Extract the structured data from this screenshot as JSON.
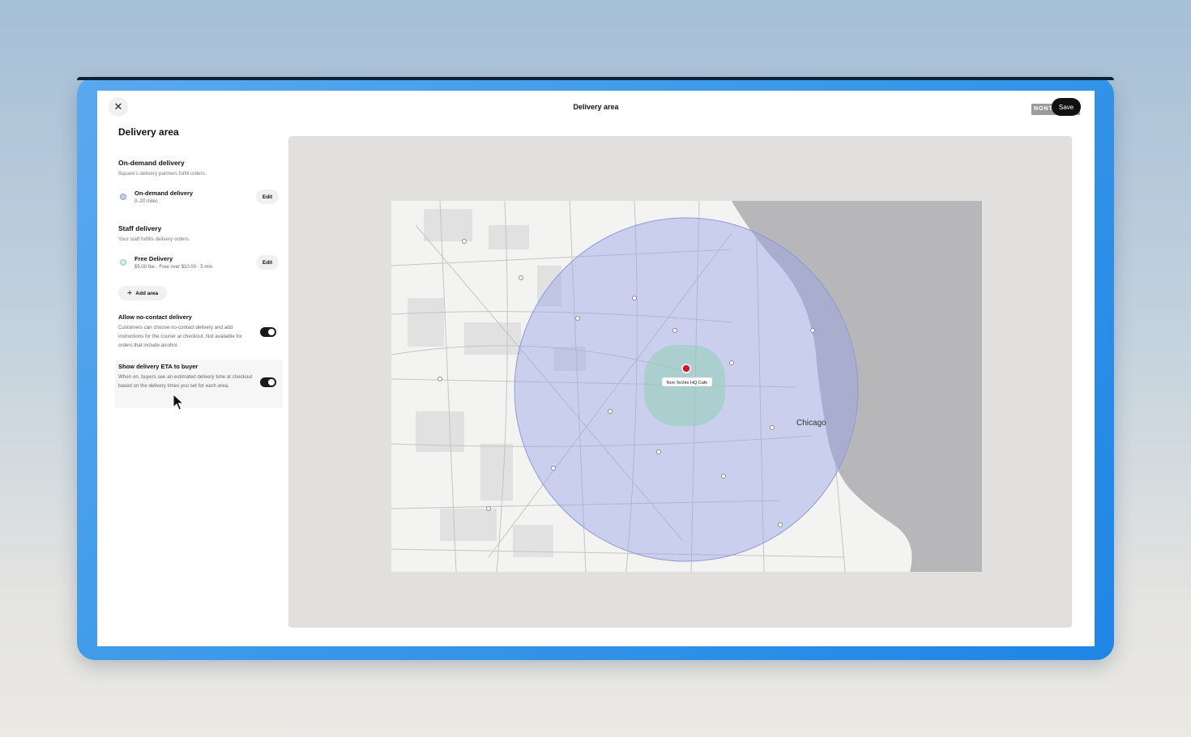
{
  "window": {
    "title": "Delivery area",
    "brand_tag": "NONT",
    "save_label": "Save",
    "close_icon": "close-icon"
  },
  "sidebar": {
    "heading": "Delivery area",
    "on_demand": {
      "title": "On-demand delivery",
      "subtitle": "Square's delivery partners fulfill orders.",
      "area": {
        "name": "On-demand delivery",
        "detail": "0–20 miles",
        "color": "#aab4e6",
        "edit_label": "Edit"
      }
    },
    "staff": {
      "title": "Staff delivery",
      "subtitle": "Your staff fulfills delivery orders.",
      "area": {
        "name": "Free Delivery",
        "detail": "$5.00 fee · Free over $10.00 · 5 min",
        "color": "#a8dcc6",
        "edit_label": "Edit"
      }
    },
    "add_area_label": "Add area",
    "settings": [
      {
        "title": "Allow no-contact delivery",
        "description": "Customers can choose no-contact delivery and add instructions for the courier at checkout. Not available for orders that include alcohol.",
        "enabled": true
      },
      {
        "title": "Show delivery ETA to buyer",
        "description": "When on, buyers see an estimated delivery time at checkout based on the delivery times you set for each area.",
        "enabled": true
      }
    ]
  },
  "map": {
    "city_label": "Chicago",
    "pin_label": "Non-Techie HQ Cafe",
    "on_demand_zone_color": "#9aa5e8",
    "staff_zone_color": "#8fd0b4",
    "pin_color": "#d0192b",
    "water_color": "#b7b6b8"
  }
}
